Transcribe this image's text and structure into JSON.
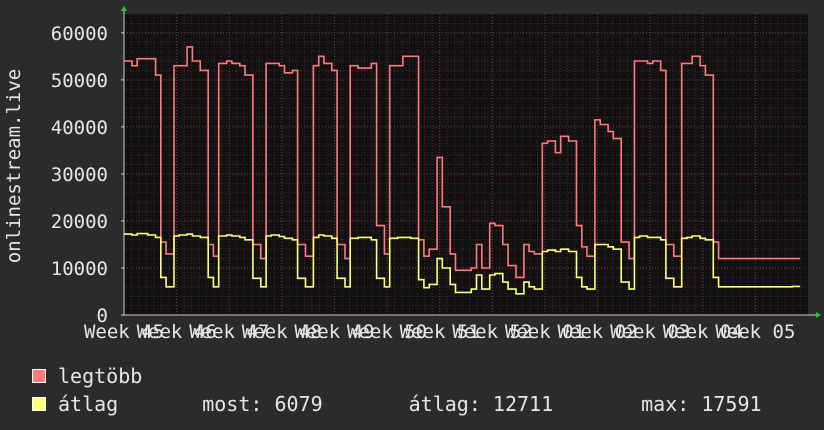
{
  "chart_data": {
    "type": "line",
    "ylabel": "onlinestream.live",
    "ylim": [
      0,
      64000
    ],
    "yticks": [
      0,
      10000,
      20000,
      30000,
      40000,
      50000,
      60000
    ],
    "ytick_labels": [
      "0",
      "10000",
      "20000",
      "30000",
      "40000",
      "50000",
      "60000"
    ],
    "x_tick_labels": [
      "Week 45",
      "Week 46",
      "Week 47",
      "Week 48",
      "Week 49",
      "Week 50",
      "Week 51",
      "Week 52",
      "Week 01",
      "Week 02",
      "Week 03",
      "Week 04",
      "Week 05"
    ],
    "x_range": [
      0,
      13
    ],
    "x": [
      0,
      0.15,
      0.25,
      0.45,
      0.6,
      0.7,
      0.8,
      0.95,
      1.05,
      1.2,
      1.3,
      1.45,
      1.6,
      1.7,
      1.8,
      1.95,
      2.05,
      2.2,
      2.3,
      2.45,
      2.6,
      2.7,
      2.8,
      2.95,
      3.05,
      3.2,
      3.3,
      3.45,
      3.6,
      3.7,
      3.8,
      3.95,
      4.05,
      4.2,
      4.3,
      4.45,
      4.6,
      4.7,
      4.8,
      4.95,
      5.05,
      5.2,
      5.3,
      5.45,
      5.6,
      5.7,
      5.8,
      5.95,
      6.05,
      6.2,
      6.3,
      6.45,
      6.6,
      6.7,
      6.8,
      6.95,
      7.05,
      7.2,
      7.3,
      7.45,
      7.6,
      7.7,
      7.8,
      7.95,
      8.05,
      8.2,
      8.3,
      8.45,
      8.6,
      8.7,
      8.8,
      8.95,
      9.05,
      9.2,
      9.3,
      9.45,
      9.6,
      9.7,
      9.8,
      9.95,
      10.05,
      10.2,
      10.3,
      10.45,
      10.6,
      10.7,
      10.8,
      10.95,
      11.05,
      11.2,
      11.3,
      11.45,
      11.6,
      11.7,
      11.8,
      11.95,
      12.05,
      12.2,
      12.3,
      12.45,
      12.6,
      12.7
    ],
    "series": [
      {
        "name": "legtöbb",
        "color": "#ff7b7b",
        "values": [
          54000,
          53000,
          54500,
          54500,
          51000,
          15500,
          13000,
          53000,
          53000,
          57000,
          54000,
          52000,
          15000,
          12500,
          53500,
          54000,
          53500,
          53000,
          51000,
          15000,
          12000,
          53500,
          53500,
          53000,
          51500,
          52000,
          15000,
          12500,
          53000,
          55000,
          53500,
          52000,
          15000,
          12000,
          53000,
          52500,
          52500,
          53500,
          19000,
          13000,
          53000,
          53000,
          55000,
          55000,
          16000,
          12500,
          14000,
          33500,
          23000,
          13000,
          9500,
          9500,
          10000,
          15000,
          10000,
          19500,
          19000,
          15000,
          10500,
          8000,
          15000,
          13500,
          13000,
          36500,
          37000,
          34500,
          38000,
          37000,
          19000,
          14500,
          12500,
          41500,
          40500,
          39000,
          37500,
          15500,
          12000,
          54000,
          54000,
          53500,
          54000,
          52000,
          15000,
          12500,
          53500,
          53500,
          55000,
          53000,
          51000,
          15500,
          12000,
          12000,
          12000,
          12000,
          12000,
          12000,
          12000,
          12000,
          12000,
          12000,
          12000,
          12000
        ]
      },
      {
        "name": "átlag",
        "color": "#ffff80",
        "values": [
          17200,
          17000,
          17300,
          17000,
          16500,
          8000,
          6000,
          16800,
          17000,
          17200,
          16800,
          16500,
          8000,
          6000,
          16800,
          17000,
          16800,
          16500,
          16000,
          7800,
          6000,
          16800,
          17000,
          16700,
          16300,
          16000,
          7800,
          6000,
          16500,
          17000,
          16800,
          16300,
          7800,
          6000,
          16300,
          16500,
          16500,
          16000,
          7800,
          6000,
          16300,
          16500,
          16500,
          16300,
          7500,
          5800,
          6500,
          12000,
          10000,
          6500,
          4800,
          4800,
          5500,
          8500,
          5500,
          8500,
          8800,
          7000,
          5500,
          4500,
          7000,
          6000,
          5500,
          13500,
          13800,
          13500,
          14000,
          13500,
          8000,
          6000,
          5500,
          15000,
          15000,
          14500,
          14000,
          7000,
          5500,
          16500,
          16800,
          16500,
          16500,
          16000,
          7800,
          6000,
          16300,
          16500,
          16800,
          16300,
          16000,
          8000,
          6000,
          6000,
          6000,
          6000,
          6000,
          6000,
          6000,
          6000,
          6000,
          6000,
          6000,
          6079
        ]
      }
    ],
    "grid": true,
    "legend": "bottom"
  },
  "legend": {
    "items": [
      {
        "label": "legtöbb",
        "color": "#ff7b7b"
      },
      {
        "label": "átlag",
        "color": "#ffff80"
      }
    ],
    "stats": {
      "most": "most: 6079",
      "atlag": "átlag: 12711",
      "max": "max: 17591"
    }
  }
}
